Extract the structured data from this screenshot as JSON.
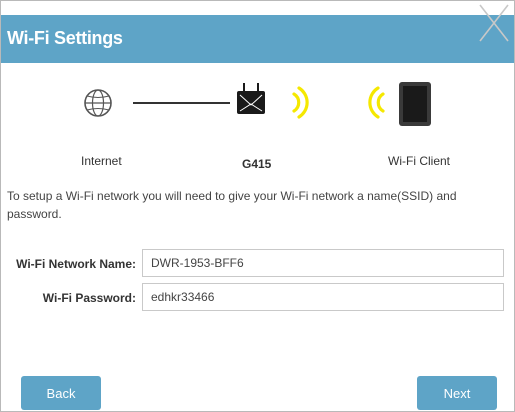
{
  "dialog": {
    "title": "Wi-Fi Settings",
    "close_icon": "close-x-icon"
  },
  "diagram": {
    "internet_label": "Internet",
    "device_label": "G415",
    "client_label": "Wi-Fi Client",
    "icons": [
      "globe-icon",
      "router-icon",
      "wifi-signal-icon",
      "tablet-icon"
    ],
    "signal_color": "#f5e800"
  },
  "instructions": "To setup a Wi-Fi network you will need to give your Wi-Fi network a name(SSID) and password.",
  "form": {
    "ssid_label": "Wi-Fi Network Name:",
    "ssid_value": "DWR-1953-BFF6",
    "password_label": "Wi-Fi Password:",
    "password_value": "edhkr33466"
  },
  "buttons": {
    "back_label": "Back",
    "next_label": "Next"
  },
  "colors": {
    "accent": "#5ea4c7"
  }
}
